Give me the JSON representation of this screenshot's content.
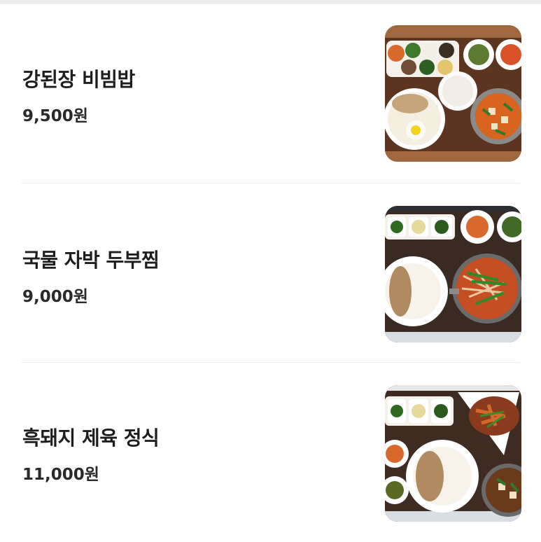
{
  "menu": {
    "items": [
      {
        "name": "강된장 비빔밥",
        "price": "9,500원",
        "image_icon": "bibimbap-set-photo"
      },
      {
        "name": "국물 자박 두부찜",
        "price": "9,000원",
        "image_icon": "braised-tofu-set-photo"
      },
      {
        "name": "흑돼지 제육 정식",
        "price": "11,000원",
        "image_icon": "pork-set-photo"
      }
    ]
  },
  "colors": {
    "title_text": "#1e1e1e",
    "price_text": "#2a2a2a",
    "divider": "#eeeeee",
    "top_strip": "#ececec"
  }
}
